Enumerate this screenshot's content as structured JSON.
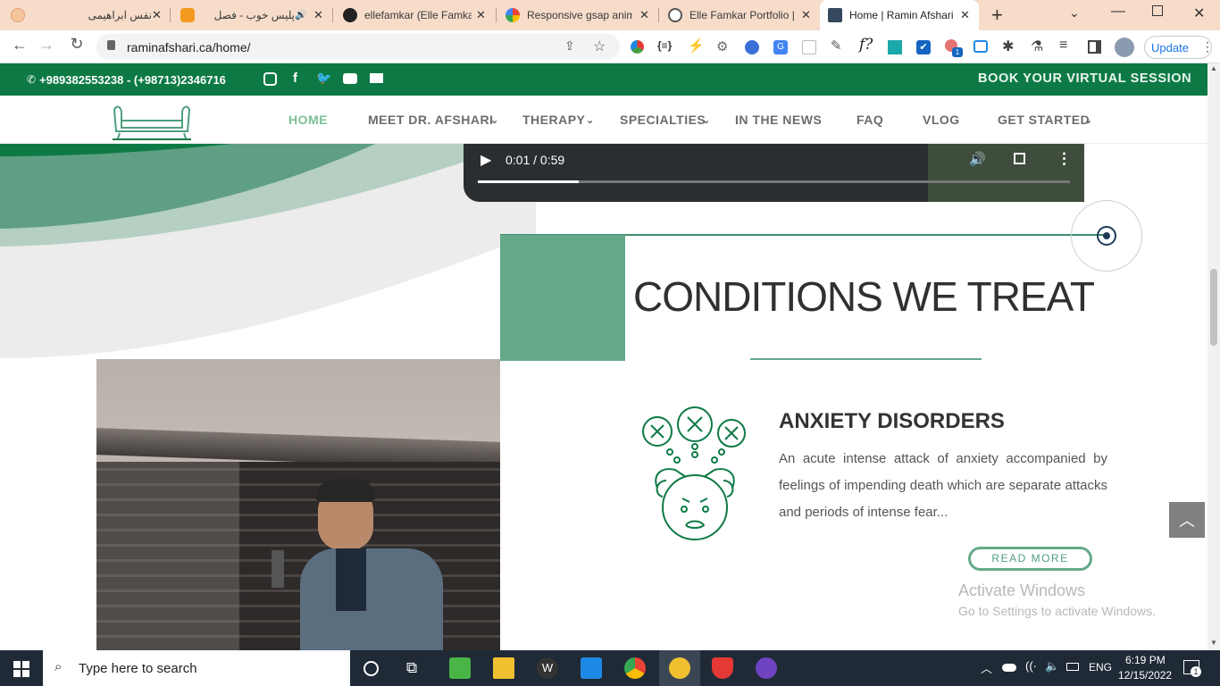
{
  "browser": {
    "tabs": [
      {
        "title": "نفس ابراهیمی",
        "close": "✕"
      },
      {
        "title": "پلیس خوب - فصل",
        "close": "✕"
      },
      {
        "title": "ellefamkar (Elle Famkar)",
        "close": "✕"
      },
      {
        "title": "Responsive gsap animation",
        "close": "✕"
      },
      {
        "title": "Elle Famkar Portfolio |",
        "close": "✕"
      },
      {
        "title": "Home | Ramin Afshari",
        "close": "✕"
      }
    ],
    "new_tab": "+",
    "url": "raminafshari.ca/home/",
    "update_label": "Update"
  },
  "site": {
    "phone": "+989382553238 - (+98713)2346716",
    "book_cta": "BOOK YOUR VIRTUAL SESSION",
    "nav": [
      {
        "label": "HOME",
        "dropdown": false
      },
      {
        "label": "MEET DR. AFSHARI",
        "dropdown": true
      },
      {
        "label": "THERAPY",
        "dropdown": true
      },
      {
        "label": "SPECIALTIES",
        "dropdown": true
      },
      {
        "label": "IN THE NEWS",
        "dropdown": false
      },
      {
        "label": "FAQ",
        "dropdown": false
      },
      {
        "label": "VLOG",
        "dropdown": false
      },
      {
        "label": "GET STARTED",
        "dropdown": true
      }
    ],
    "video": {
      "time": "0:01 / 0:59",
      "progress": 0.17
    },
    "section_title": "CONDITIONS WE TREAT",
    "condition": {
      "title": "ANXIETY DISORDERS",
      "description": "An acute intense attack of anxiety accompanied by feelings of impending death which are separate attacks and periods of intense fear...",
      "read_more": "READ MORE"
    },
    "watermark": {
      "title": "Activate Windows",
      "subtitle": "Go to Settings to activate Windows."
    }
  },
  "taskbar": {
    "search_placeholder": "Type here to search",
    "language": "ENG",
    "time": "6:19 PM",
    "date": "12/15/2022",
    "notifications": "1"
  },
  "colors": {
    "brand_green": "#0d7a45",
    "accent_green": "#66a98a",
    "nav_active": "#7cc09a"
  }
}
